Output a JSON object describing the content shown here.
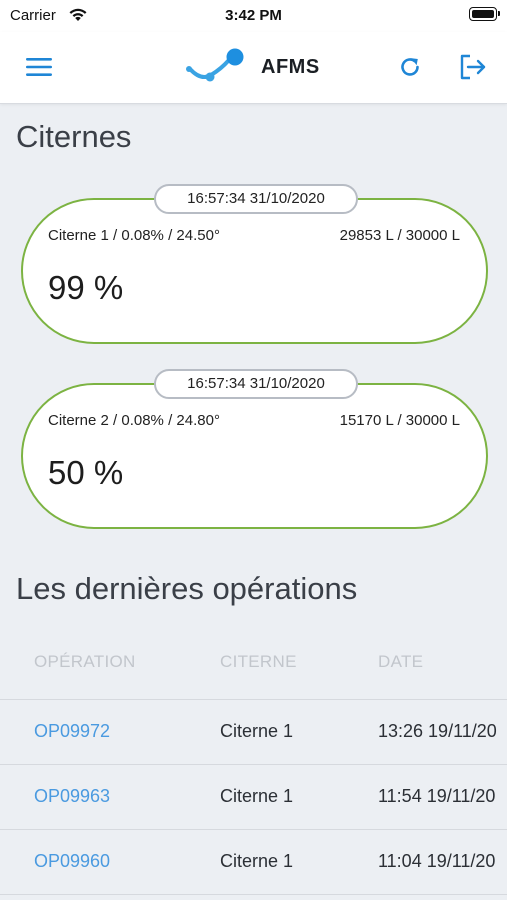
{
  "status_bar": {
    "carrier": "Carrier",
    "time": "3:42 PM"
  },
  "header": {
    "app_name": "AFMS"
  },
  "sections": {
    "tanks_title": "Citernes",
    "operations_title": "Les dernières opérations"
  },
  "tanks": [
    {
      "timestamp": "16:57:34 31/10/2020",
      "info": "Citerne 1 / 0.08% / 24.50°",
      "volume": "29853 L / 30000 L",
      "percent": "99 %"
    },
    {
      "timestamp": "16:57:34 31/10/2020",
      "info": "Citerne 2 / 0.08% / 24.80°",
      "volume": "15170 L / 30000 L",
      "percent": "50 %"
    }
  ],
  "operations_table": {
    "columns": [
      "OPÉRATION",
      "CITERNE",
      "DATE"
    ],
    "rows": [
      {
        "operation": "OP09972",
        "tank": "Citerne 1",
        "date": "13:26 19/11/20"
      },
      {
        "operation": "OP09963",
        "tank": "Citerne 1",
        "date": "11:54 19/11/20"
      },
      {
        "operation": "OP09960",
        "tank": "Citerne 1",
        "date": "11:04 19/11/20"
      }
    ]
  },
  "colors": {
    "accent": "#1f86d6",
    "tank_border": "#7cb342",
    "link": "#4a9ae0",
    "logo": "#3aa3e3"
  },
  "icons": [
    "menu-icon",
    "refresh-icon",
    "logout-icon",
    "wifi-icon",
    "battery-icon",
    "afms-logo"
  ]
}
